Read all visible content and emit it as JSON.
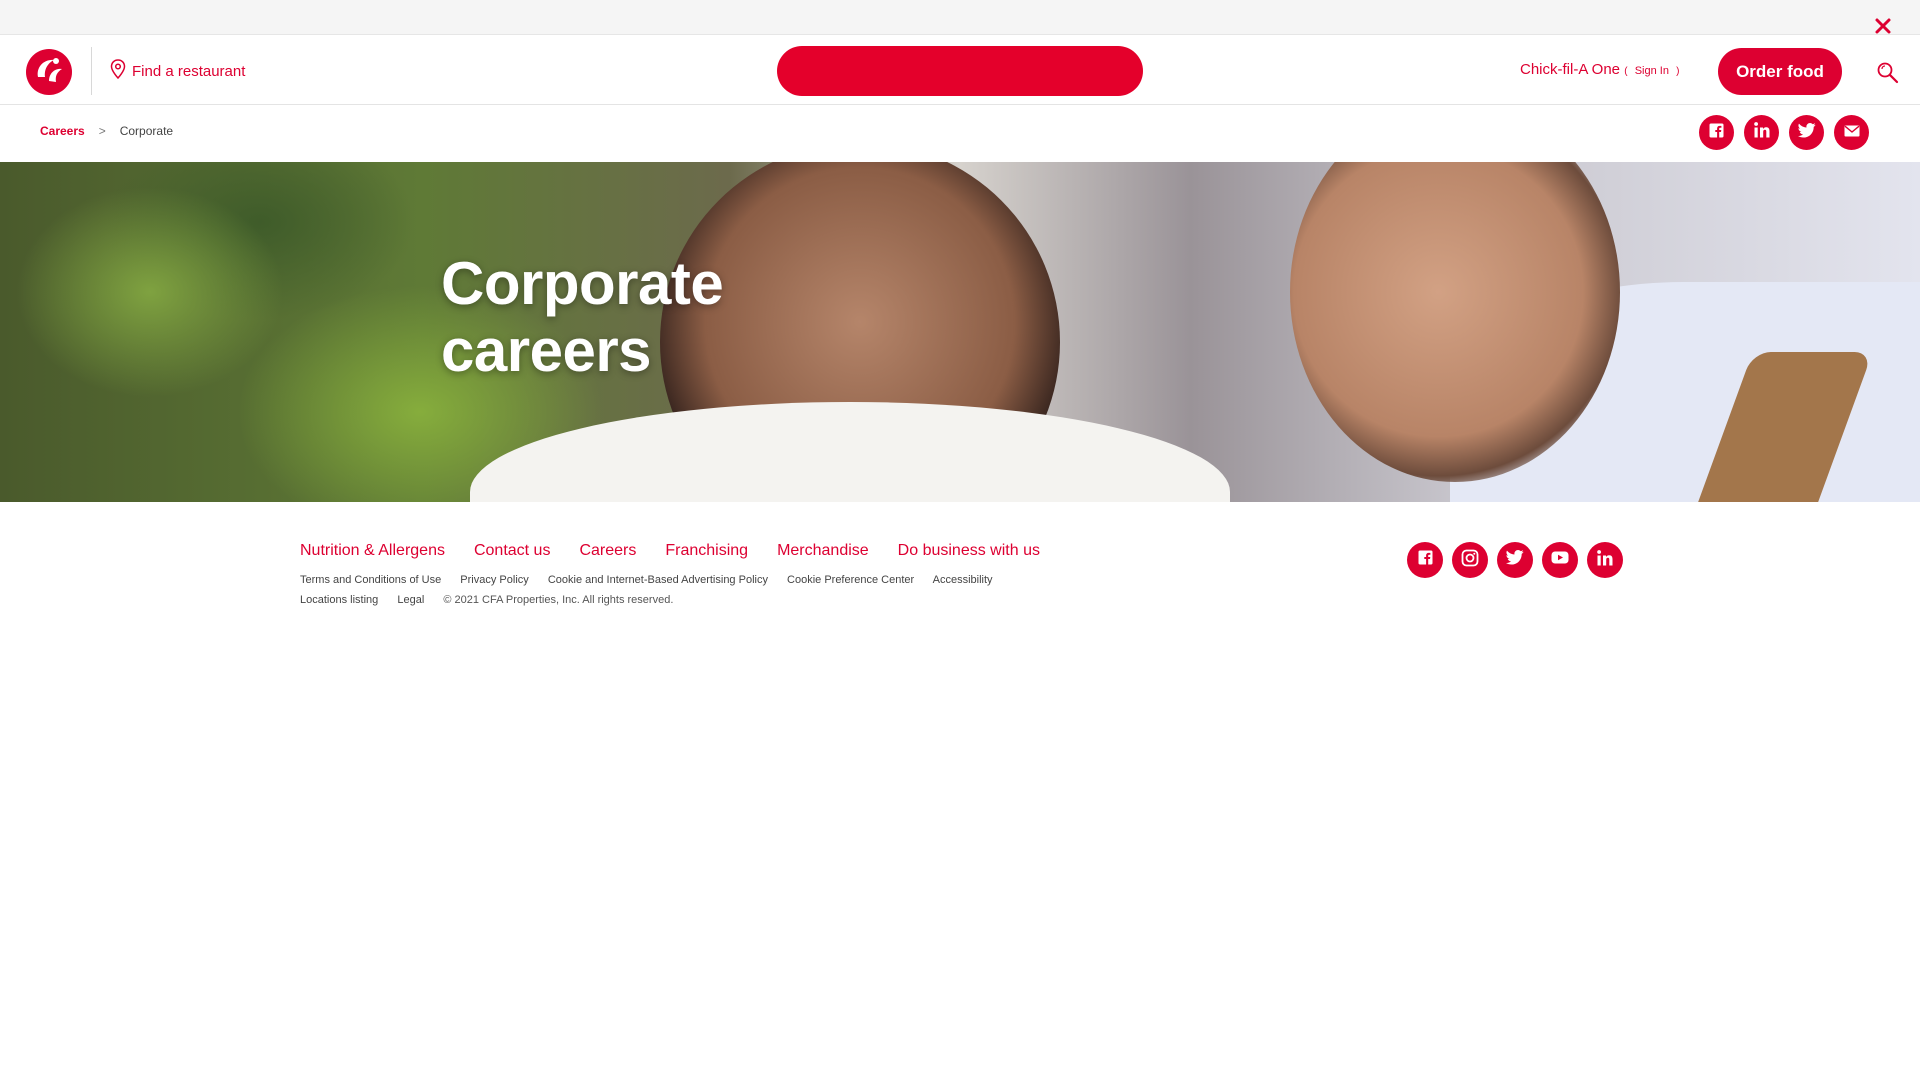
{
  "topbar": {
    "close_label": "Close"
  },
  "header": {
    "find_restaurant": "Find a restaurant",
    "cfa_one": {
      "label": "Chick-fil-A One",
      "open_paren": "(",
      "sign_in": "Sign In",
      "close_paren": ")"
    },
    "order_button": "Order food"
  },
  "breadcrumb": {
    "parent": "Careers",
    "separator": ">",
    "current": "Corporate"
  },
  "share_icons": [
    "facebook-icon",
    "linkedin-icon",
    "twitter-icon",
    "mail-icon"
  ],
  "hero": {
    "title_line1": "Corporate",
    "title_line2": "careers"
  },
  "footer": {
    "links": [
      "Nutrition & Allergens",
      "Contact us",
      "Careers",
      "Franchising",
      "Merchandise",
      "Do business with us"
    ],
    "legal_links": [
      "Terms and Conditions of Use",
      "Privacy Policy",
      "Cookie and Internet-Based Advertising Policy",
      "Cookie Preference Center",
      "Accessibility",
      "Locations listing",
      "Legal"
    ],
    "copyright": "© 2021 CFA Properties, Inc. All rights reserved.",
    "social_icons": [
      "facebook-icon",
      "instagram-icon",
      "twitter-icon",
      "youtube-icon",
      "linkedin-icon"
    ]
  },
  "colors": {
    "brand_red": "#dd0031",
    "pill_red": "#e4002b",
    "topbar_gray": "#f5f5f5"
  }
}
